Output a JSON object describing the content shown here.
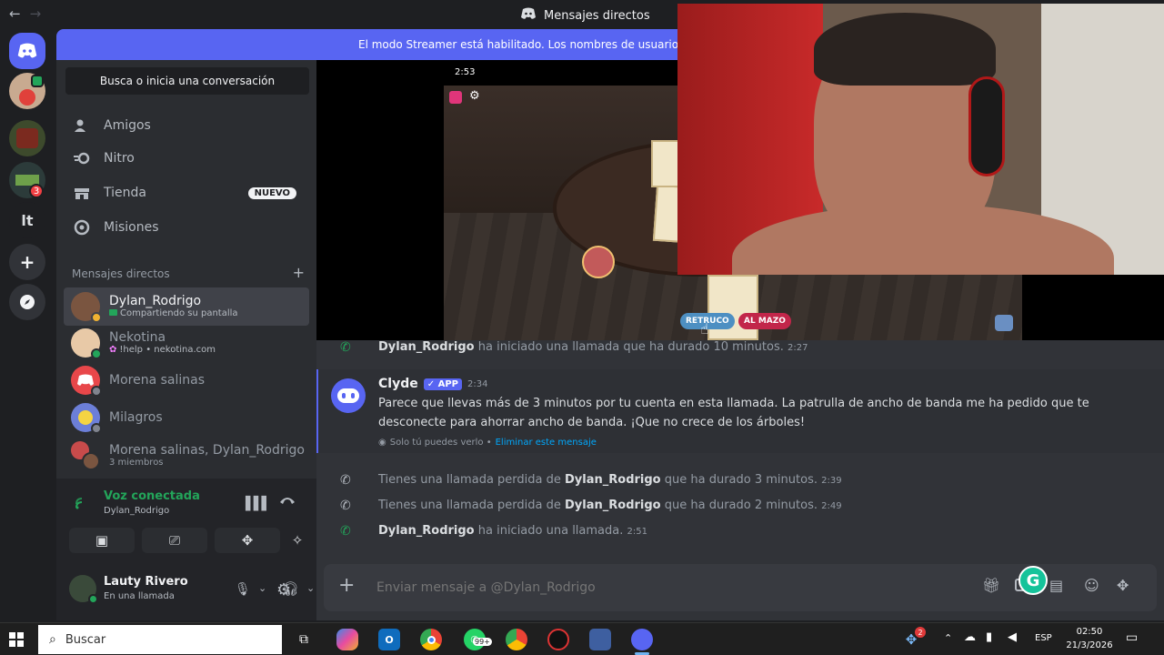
{
  "topbar": {
    "back": "←",
    "forward": "→",
    "title": "Mensajes directos"
  },
  "banner": {
    "text": "El modo Streamer está habilitado. Los nombres de usuario se l"
  },
  "servers": [
    {
      "label": "",
      "badge": ""
    },
    {
      "label": "",
      "badge": ""
    },
    {
      "label": "",
      "badge": "3"
    },
    {
      "label": "lt"
    },
    {
      "label": "+"
    }
  ],
  "sidebar": {
    "search": "Busca o inicia una conversación",
    "nav": [
      {
        "label": "Amigos",
        "icon": "friends-icon"
      },
      {
        "label": "Nitro",
        "icon": "nitro-icon"
      },
      {
        "label": "Tienda",
        "icon": "shop-icon",
        "badge": "NUEVO"
      },
      {
        "label": "Misiones",
        "icon": "quests-icon"
      }
    ],
    "dm_header": "Mensajes directos",
    "dm_add": "+",
    "dms": [
      {
        "name": "Dylan_Rodrigo",
        "sub": "Compartiendo su pantalla",
        "color": "#7a5540"
      },
      {
        "name": "Nekotina",
        "sub": "!help • nekotina.com",
        "color": "#e8c9a7"
      },
      {
        "name": "Morena salinas",
        "sub": "",
        "color": "#e8474a"
      },
      {
        "name": "Milagros",
        "sub": "",
        "color": "#6c7fd8"
      },
      {
        "name": "Morena salinas, Dylan_Rodrigo",
        "sub": "3 miembros",
        "color": "#c84b4b"
      }
    ]
  },
  "voice": {
    "status": "Voz conectada",
    "channel": "Dylan_Rodrigo"
  },
  "user": {
    "name": "Lauty Rivero",
    "status": "En una llamada"
  },
  "stream": {
    "phone_time": "2:53",
    "btn_retruco": "RETRUCO",
    "btn_mazo": "AL MAZO"
  },
  "messages": {
    "call1": {
      "user": "Dylan_Rodrigo",
      "text": "ha iniciado una llamada que ha durado 10 minutos.",
      "time": "2:27"
    },
    "clyde": {
      "author": "Clyde",
      "tag": "APP",
      "time": "2:34",
      "line1": "Parece que llevas más de 3 minutos por tu cuenta en esta llamada. La patrulla de ancho de banda me ha pedido que te",
      "line2": "desconecte para ahorrar ancho de banda. ¡Que no crece de los árboles!",
      "only_you": "Solo tú puedes verlo •",
      "delete": "Eliminar este mensaje"
    },
    "missed1": {
      "pre": "Tienes una llamada perdida de",
      "user": "Dylan_Rodrigo",
      "post": "que ha durado 3 minutos.",
      "time": "2:39"
    },
    "missed2": {
      "pre": "Tienes una llamada perdida de",
      "user": "Dylan_Rodrigo",
      "post": "que ha durado 2 minutos.",
      "time": "2:49"
    },
    "call2": {
      "user": "Dylan_Rodrigo",
      "text": "ha iniciado una llamada.",
      "time": "2:51"
    }
  },
  "composer": {
    "placeholder": "Enviar mensaje a @Dylan_Rodrigo",
    "gif": "GIF"
  },
  "taskbar": {
    "search": "Buscar",
    "lang": "ESP",
    "time": "02:50",
    "date": "21/3/2026",
    "whatsapp_badge": "99+",
    "widgets_badge": "2"
  }
}
